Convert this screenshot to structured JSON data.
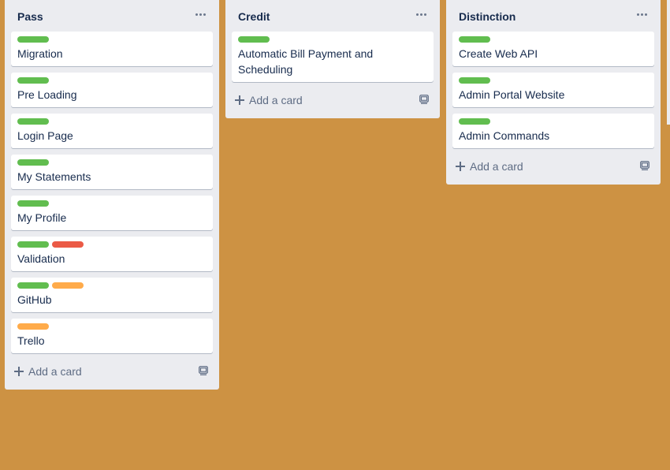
{
  "board": {
    "lists": [
      {
        "title": "Pass",
        "cards": [
          {
            "title": "Migration",
            "labels": [
              "green"
            ]
          },
          {
            "title": "Pre Loading",
            "labels": [
              "green"
            ]
          },
          {
            "title": "Login Page",
            "labels": [
              "green"
            ]
          },
          {
            "title": "My Statements",
            "labels": [
              "green"
            ]
          },
          {
            "title": "My Profile",
            "labels": [
              "green"
            ]
          },
          {
            "title": "Validation",
            "labels": [
              "green",
              "red"
            ]
          },
          {
            "title": "GitHub",
            "labels": [
              "green",
              "orange"
            ]
          },
          {
            "title": "Trello",
            "labels": [
              "orange"
            ]
          }
        ],
        "add_card_label": "Add a card"
      },
      {
        "title": "Credit",
        "cards": [
          {
            "title": "Automatic Bill Payment and Scheduling",
            "labels": [
              "green"
            ]
          }
        ],
        "add_card_label": "Add a card"
      },
      {
        "title": "Distinction",
        "cards": [
          {
            "title": "Create Web API",
            "labels": [
              "green"
            ]
          },
          {
            "title": "Admin Portal Website",
            "labels": [
              "green"
            ]
          },
          {
            "title": "Admin Commands",
            "labels": [
              "green"
            ]
          }
        ],
        "add_card_label": "Add a card"
      }
    ]
  },
  "colors": {
    "board_background": "#cd9243",
    "list_background": "#ebecf0",
    "label_green": "#61bd4f",
    "label_red": "#eb5a46",
    "label_orange": "#ffab4a"
  },
  "icons": {
    "list_menu": "more-horizontal-icon",
    "add": "plus-icon",
    "template": "card-template-icon"
  }
}
